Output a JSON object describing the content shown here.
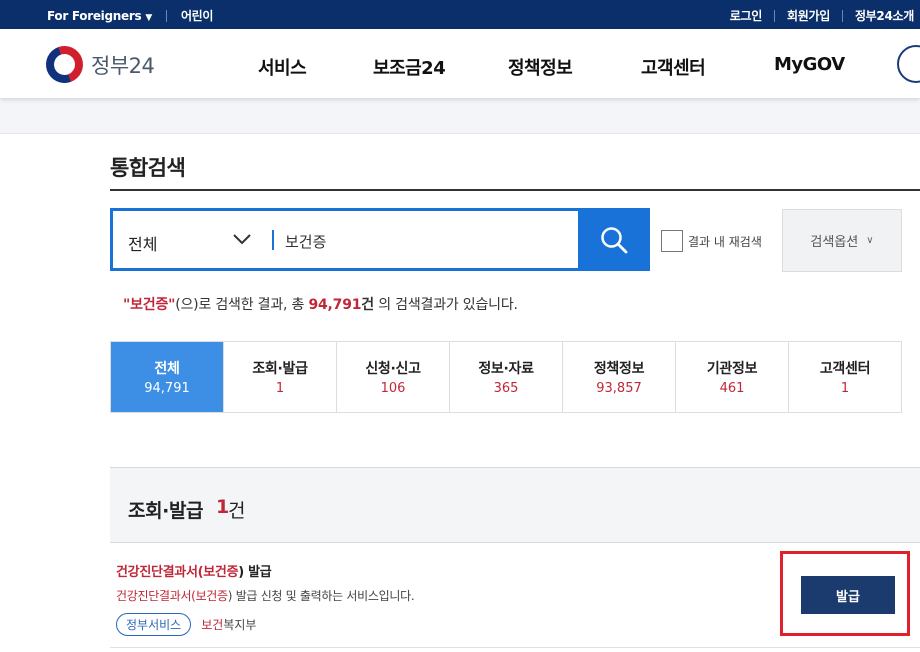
{
  "topbar": {
    "foreigners": "For Foreigners",
    "kids": "어린이",
    "login": "로그인",
    "signup": "회원가입",
    "about": "정부24소개"
  },
  "header": {
    "logo_text": "정부24",
    "nav": [
      "서비스",
      "보조금24",
      "정책정보",
      "고객센터",
      "MyGOV"
    ]
  },
  "page": {
    "title": "통합검색"
  },
  "search": {
    "scope": "전체",
    "query": "보건증",
    "recheck_label": "결과 내 재검색",
    "options_label": "검색옵션"
  },
  "summary": {
    "keyword": "\"보건증\"",
    "text1": "(으)로 검색한 결과, 총 ",
    "total": "94,791",
    "text2": "건",
    "text3": " 의 검색결과가 있습니다."
  },
  "tabs": [
    {
      "label": "전체",
      "count": "94,791"
    },
    {
      "label": "조회·발급",
      "count": "1"
    },
    {
      "label": "신청·신고",
      "count": "106"
    },
    {
      "label": "정보·자료",
      "count": "365"
    },
    {
      "label": "정책정보",
      "count": "93,857"
    },
    {
      "label": "기관정보",
      "count": "461"
    },
    {
      "label": "고객센터",
      "count": "1"
    }
  ],
  "section": {
    "title": "조회·발급",
    "count": "1",
    "unit": "건"
  },
  "result": {
    "title_pre": "건강진단결과서(",
    "title_hl": "보건증",
    "title_post": ") 발급",
    "desc_pre": "건강진단결과서(",
    "desc_hl": "보건증",
    "desc_post": ") 발급 신청 및 출력하는 서비스입니다.",
    "tag": "정부서비스",
    "agency_hl": "보건",
    "agency_rest": "복지부",
    "button": "발급"
  },
  "colors": {
    "topbar": "#0b2f6b",
    "accent": "#1872d8",
    "active_tab": "#3c8fe4",
    "highlight": "#c0283a",
    "issue_button": "#1b3a6e",
    "frame": "#e0202a"
  }
}
